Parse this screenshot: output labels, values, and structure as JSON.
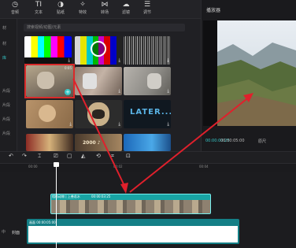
{
  "toolbar": {
    "items": [
      {
        "label": "音频",
        "icon": "clock-icon"
      },
      {
        "label": "文本",
        "icon": "text-icon"
      },
      {
        "label": "贴纸",
        "icon": "sticker-icon"
      },
      {
        "label": "特效",
        "icon": "star-icon"
      },
      {
        "label": "转场",
        "icon": "transition-icon"
      },
      {
        "label": "滤镜",
        "icon": "filter-icon"
      },
      {
        "label": "调节",
        "icon": "adjust-icon"
      }
    ]
  },
  "sidebar": {
    "items": [
      {
        "label": "材"
      },
      {
        "label": "材"
      },
      {
        "label": "库"
      },
      {
        "label": ""
      },
      {
        "label": "片段"
      },
      {
        "label": "片段"
      },
      {
        "label": "片段"
      },
      {
        "label": "片段"
      }
    ],
    "active_index": 2
  },
  "media": {
    "search_placeholder": "搜索视频/动图/元素"
  },
  "player": {
    "title": "播放器",
    "current_time": "00:00:00:25",
    "total_time": "00:00:05:00",
    "mode": "原尺"
  },
  "timeline": {
    "ruler_labels": [
      "00:00",
      "00:02",
      "00:04"
    ],
    "clip_label": "相机动物",
    "clip_speed": "上善若水",
    "clip_duration": "00:00:03:25",
    "main_track_time": "00:00:05:00",
    "main_track_label": "画面",
    "cover_label": "封面",
    "track_prefix": "中"
  },
  "colors": {
    "accent": "#36c7c7",
    "clip": "#18a4a4",
    "arrow": "#e0202c"
  }
}
